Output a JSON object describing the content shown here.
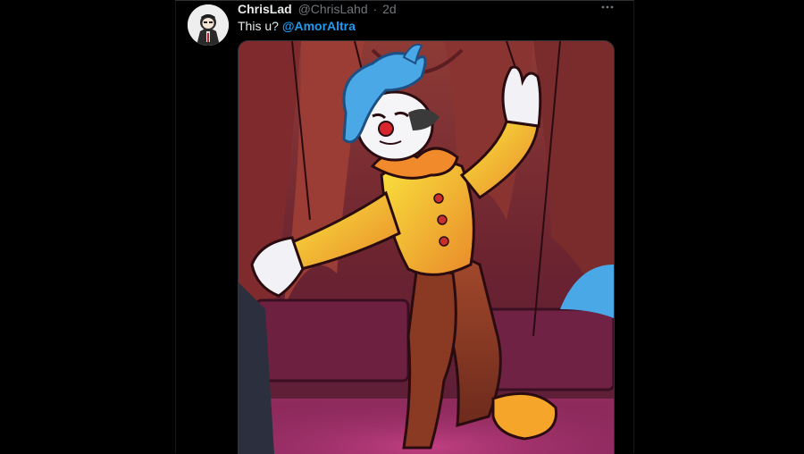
{
  "tweet": {
    "display_name": "ChrisLad",
    "handle": "@ChrisLahd",
    "separator": "·",
    "time": "2d",
    "text": "This u?",
    "mention": "@AmorAltra",
    "more_icon": "more-horizontal-icon"
  },
  "colors": {
    "background": "#000000",
    "text_primary": "#e7e9ea",
    "text_secondary": "#71767b",
    "link": "#1d9bf0"
  },
  "media": {
    "subject": "clown-marionette-illustration",
    "costume_color": "#f2d22c",
    "hair_color": "#4aa8e6",
    "pants_color": "#8a3a22",
    "curtain_color": "#7a2b2c"
  }
}
